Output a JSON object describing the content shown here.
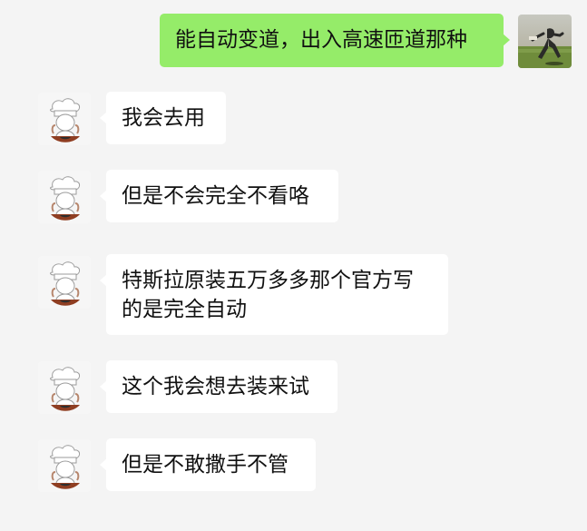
{
  "messages": [
    {
      "sender": "self",
      "text": "能自动变道，出入高速匝道那种"
    },
    {
      "sender": "other",
      "text": "我会去用"
    },
    {
      "sender": "other",
      "text": "但是不会完全不看咯"
    },
    {
      "sender": "other",
      "text_line1": "特斯拉原装五万多多那个官方写",
      "text_line2": "的是完全自动"
    },
    {
      "sender": "other",
      "text": "这个我会想去装来试"
    },
    {
      "sender": "other",
      "text": "但是不敢撒手不管"
    }
  ],
  "colors": {
    "background": "#f4f4f4",
    "outgoing_bubble": "#95ec69",
    "incoming_bubble": "#ffffff"
  },
  "icons": {
    "self_avatar": "person-running-field-photo-icon",
    "other_avatar": "chef-cartoon-avatar-icon"
  }
}
